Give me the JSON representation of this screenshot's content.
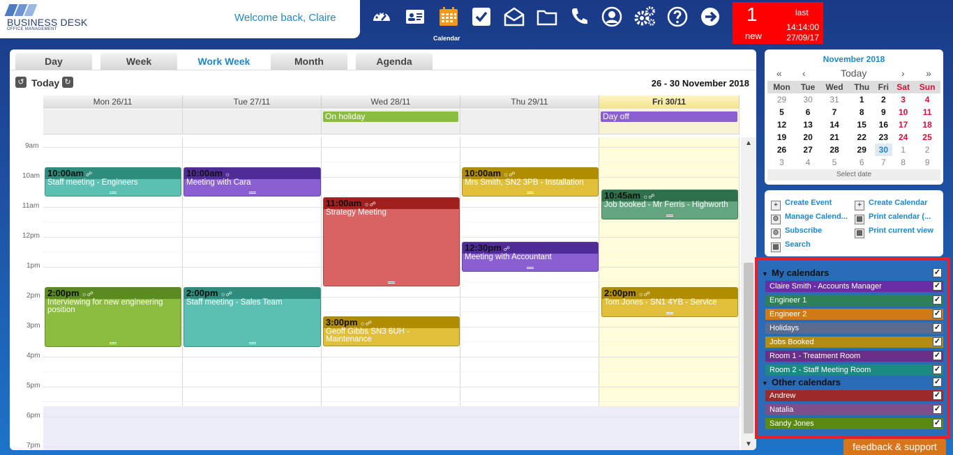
{
  "brand": {
    "name": "BUSINESS DESK",
    "sub": "OFFICE MANAGEMENT"
  },
  "welcome": "Welcome back, Claire",
  "nav": {
    "active_label": "Calendar"
  },
  "notification": {
    "count": "1",
    "new_label": "new",
    "last_label": "last",
    "time": "14:14:00",
    "date": "27/09/17"
  },
  "tabs": [
    "Day",
    "Week",
    "Work Week",
    "Month",
    "Agenda"
  ],
  "active_tab": "Work Week",
  "toolbar": {
    "today": "Today",
    "range": "26 - 30 November 2018"
  },
  "days": [
    "Mon 26/11",
    "Tue 27/11",
    "Wed 28/11",
    "Thu 29/11",
    "Fri 30/11"
  ],
  "hours": [
    "9am",
    "10am",
    "11am",
    "12pm",
    "1pm",
    "2pm",
    "3pm",
    "4pm",
    "5pm",
    "6pm",
    "7pm"
  ],
  "allday": {
    "wed": "On holiday",
    "fri": "Day off"
  },
  "events": {
    "e1": {
      "time": "10:00am",
      "title": "Staff meeting - Engineers"
    },
    "e2": {
      "time": "10:00am",
      "title": "Meeting with Cara"
    },
    "e3": {
      "time": "11:00am",
      "title": "Strategy Meeting"
    },
    "e4": {
      "time": "10:00am",
      "title": "Mrs Smith, SN2 3PB - Installation"
    },
    "e5": {
      "time": "10:45am",
      "title": "Job booked - Mr Ferris - Highworth"
    },
    "e6": {
      "time": "12:30pm",
      "title": "Meeting with Accountant"
    },
    "e7": {
      "time": "2:00pm",
      "title": "Interviewing for new engineering position"
    },
    "e8": {
      "time": "2:00pm",
      "title": "Staff meeting - Sales Team"
    },
    "e9": {
      "time": "3:00pm",
      "title": "Geoff Gibbs SN3 6UH - Maintenance"
    },
    "e10": {
      "time": "2:00pm",
      "title": "Tom Jones - SN1 4YB - Service"
    }
  },
  "mini": {
    "title": "November 2018",
    "prev_year": "«",
    "prev": "‹",
    "today": "Today",
    "next": "›",
    "next_year": "»",
    "weekdays": [
      "Mon",
      "Tue",
      "Wed",
      "Thu",
      "Fri",
      "Sat",
      "Sun"
    ],
    "weeks": [
      [
        "29",
        "30",
        "31",
        "1",
        "2",
        "3",
        "4"
      ],
      [
        "5",
        "6",
        "7",
        "8",
        "9",
        "10",
        "11"
      ],
      [
        "12",
        "13",
        "14",
        "15",
        "16",
        "17",
        "18"
      ],
      [
        "19",
        "20",
        "21",
        "22",
        "23",
        "24",
        "25"
      ],
      [
        "26",
        "27",
        "28",
        "29",
        "30",
        "1",
        "2"
      ],
      [
        "3",
        "4",
        "5",
        "6",
        "7",
        "8",
        "9"
      ]
    ],
    "select_date": "Select date"
  },
  "actions": {
    "create_event": "Create Event",
    "create_calendar": "Create Calendar",
    "manage": "Manage Calend...",
    "print": "Print calendar (...",
    "subscribe": "Subscribe",
    "print_view": "Print current view",
    "search": "Search"
  },
  "my_calendars": {
    "label": "My calendars",
    "items": [
      "Claire Smith - Accounts Manager",
      "Engineer 1",
      "Engineer 2",
      "Holidays",
      "Jobs Booked",
      "Room 1 - Treatment Room",
      "Room 2 - Staff Meeting Room"
    ]
  },
  "other_calendars": {
    "label": "Other calendars",
    "items": [
      "Andrew",
      "Natalia",
      "Sandy Jones"
    ]
  },
  "feedback": "feedback & support",
  "colors": {
    "teal": "#5bbfb2",
    "teal_head": "#2e8c7d",
    "purple": "#8a5fd1",
    "purple_head": "#4f2b96",
    "red": "#d96363",
    "red_head": "#a02020",
    "gold": "#e0bf3a",
    "gold_head": "#b08c00",
    "green": "#8bbc3f",
    "green_head": "#5a8a20",
    "darkgreen": "#62a57e",
    "darkgreen_head": "#2f6f4c"
  }
}
